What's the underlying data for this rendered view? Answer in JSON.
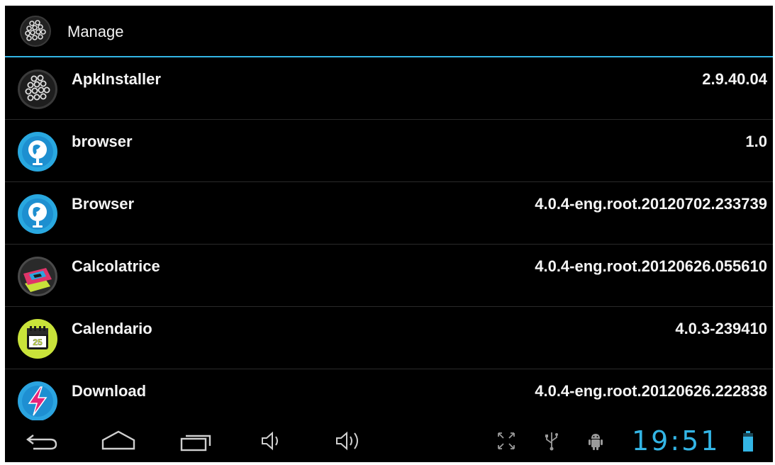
{
  "action_bar": {
    "title": "Manage",
    "icon": "apk-installer-icon"
  },
  "apps": [
    {
      "name": "ApkInstaller",
      "version": "2.9.40.04",
      "icon": "apk-installer-icon"
    },
    {
      "name": "browser",
      "version": "1.0",
      "icon": "globe-browser-icon"
    },
    {
      "name": "Browser",
      "version": "4.0.4-eng.root.20120702.233739",
      "icon": "globe-browser-icon"
    },
    {
      "name": "Calcolatrice",
      "version": "4.0.4-eng.root.20120626.055610",
      "icon": "calculator-icon"
    },
    {
      "name": "Calendario",
      "version": "4.0.3-239410",
      "icon": "calendar-icon"
    },
    {
      "name": "Download",
      "version": "4.0.4-eng.root.20120626.222838",
      "icon": "download-icon"
    }
  ],
  "calendar_icon_day": "25",
  "status_bar": {
    "clock": "19:51",
    "icons": [
      "fullscreen-icon",
      "usb-icon",
      "android-debug-icon",
      "battery-icon"
    ]
  },
  "nav_buttons": [
    "back-icon",
    "home-icon",
    "recent-apps-icon",
    "volume-down-icon",
    "volume-up-icon"
  ],
  "colors": {
    "accent": "#33b5e5",
    "background": "#000000",
    "text": "#f4f4f4"
  }
}
